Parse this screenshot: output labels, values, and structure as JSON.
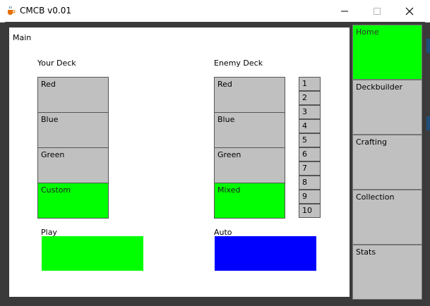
{
  "window": {
    "title": "CMCB v0.01",
    "controls": {
      "minimize": "minimize",
      "maximize": "maximize",
      "close": "close"
    }
  },
  "main": {
    "section_label": "Main",
    "your_deck": {
      "label": "Your Deck",
      "options": [
        "Red",
        "Blue",
        "Green",
        "Custom"
      ],
      "selected": "Custom"
    },
    "enemy_deck": {
      "label": "Enemy Deck",
      "options": [
        "Red",
        "Blue",
        "Green",
        "Mixed"
      ],
      "selected": "Mixed"
    },
    "levels": [
      "1",
      "2",
      "3",
      "4",
      "5",
      "6",
      "7",
      "8",
      "9",
      "10"
    ],
    "play": {
      "label": "Play",
      "color": "#00ff00"
    },
    "auto": {
      "label": "Auto",
      "color": "#0000ff"
    }
  },
  "sidebar": {
    "items": [
      "Home",
      "Deckbuilder",
      "Crafting",
      "Collection",
      "Stats"
    ],
    "active": "Home"
  },
  "colors": {
    "selected": "#00ff00",
    "unselected": "#c0c0c0",
    "frame": "#3a3a3a"
  },
  "icons": {
    "app": "java-cup-icon",
    "minimize": "minimize-icon",
    "maximize": "maximize-icon",
    "close": "close-icon"
  }
}
